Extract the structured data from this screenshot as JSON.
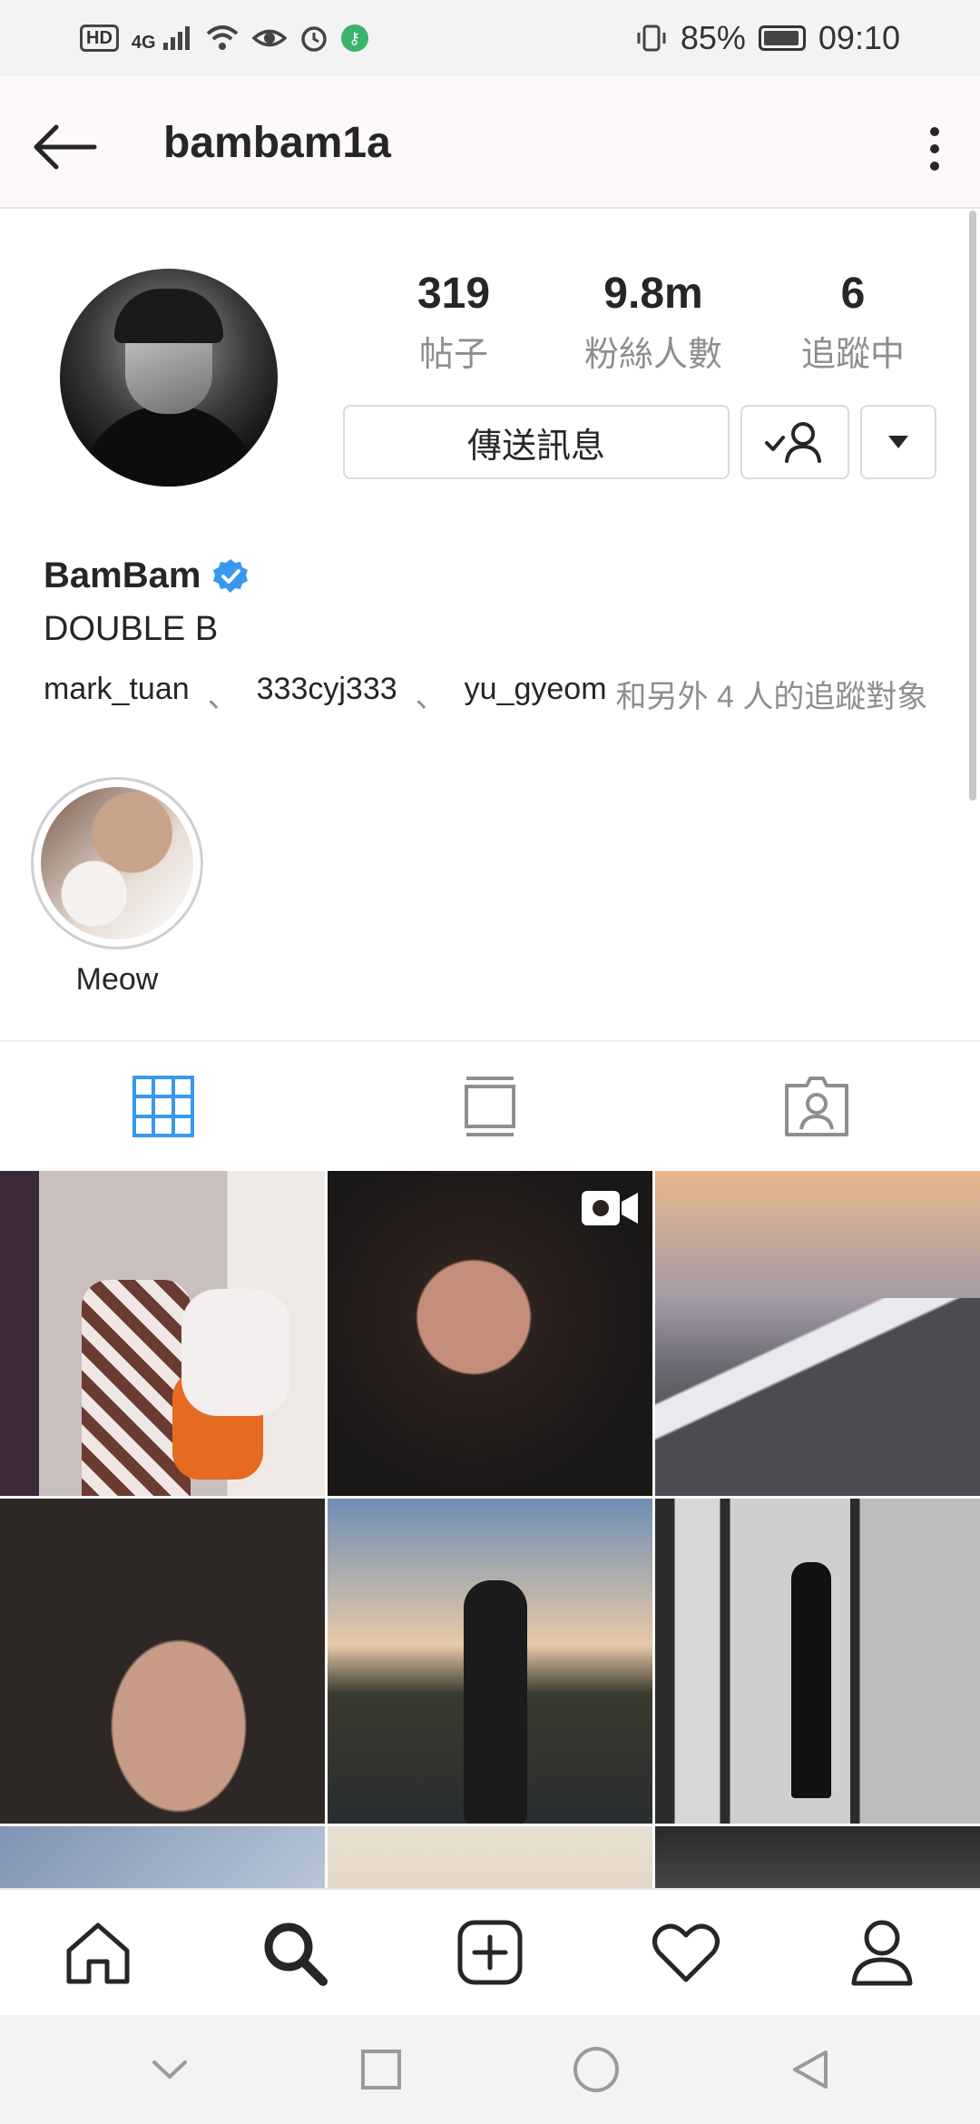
{
  "status_bar": {
    "network": "4G",
    "battery": "85%",
    "time": "09:10"
  },
  "header": {
    "username": "bambam1a"
  },
  "profile": {
    "stats": [
      {
        "value": "319",
        "label": "帖子"
      },
      {
        "value": "9.8m",
        "label": "粉絲人數"
      },
      {
        "value": "6",
        "label": "追蹤中"
      }
    ],
    "message_button": "傳送訊息",
    "name": "BamBam",
    "bio": "DOUBLE B",
    "followed_by": {
      "users": [
        "mark_tuan",
        "333cyj333",
        "yu_gyeom"
      ],
      "separator": "、",
      "rest": "和另外 4 人的追蹤對象"
    }
  },
  "highlights": [
    {
      "label": "Meow"
    }
  ],
  "tabs": [
    {
      "icon": "grid-icon",
      "active": true
    },
    {
      "icon": "feed-icon",
      "active": false
    },
    {
      "icon": "tagged-icon",
      "active": false
    }
  ],
  "colors": {
    "accent": "#3897f0",
    "verified": "#3897f0",
    "text": "#262626",
    "muted": "#8e8e8e"
  }
}
